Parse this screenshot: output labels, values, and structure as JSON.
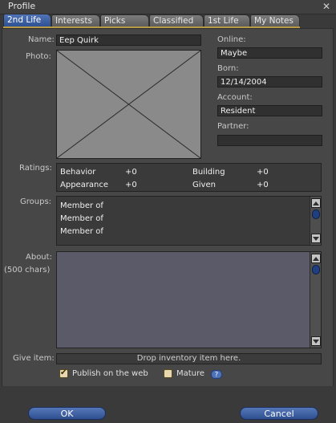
{
  "window": {
    "title": "Profile",
    "close_glyph": "✕"
  },
  "tabs": [
    {
      "label": "2nd Life",
      "active": true
    },
    {
      "label": "Interests",
      "active": false
    },
    {
      "label": "Picks",
      "active": false
    },
    {
      "label": "Classified",
      "active": false
    },
    {
      "label": "1st Life",
      "active": false
    },
    {
      "label": "My Notes",
      "active": false
    }
  ],
  "labels": {
    "name": "Name:",
    "photo": "Photo:",
    "online": "Online:",
    "born": "Born:",
    "account": "Account:",
    "partner": "Partner:",
    "ratings": "Ratings:",
    "groups": "Groups:",
    "about": "About:",
    "about_hint": "(500 chars)",
    "give_item": "Give item:"
  },
  "values": {
    "name": "Eep Quirk",
    "online": "Maybe",
    "born": "12/14/2004",
    "account": "Resident",
    "partner": ""
  },
  "ratings": [
    {
      "label": "Behavior",
      "value": "+0"
    },
    {
      "label": "Building",
      "value": "+0"
    },
    {
      "label": "Appearance",
      "value": "+0"
    },
    {
      "label": "Given",
      "value": "+0"
    }
  ],
  "groups": [
    "Member of",
    "Member of",
    "Member of"
  ],
  "about_text": "",
  "give_item_placeholder": "Drop inventory item here.",
  "options": {
    "publish_label": "Publish on the web",
    "publish_checked": true,
    "mature_label": "Mature",
    "mature_checked": false,
    "help_glyph": "?"
  },
  "buttons": {
    "ok": "OK",
    "cancel": "Cancel"
  },
  "colors": {
    "accent": "#4f73b6",
    "tab_underline": "#b89a46",
    "panel": "#474747"
  },
  "icons": {
    "close": "close-icon",
    "help": "help-icon",
    "scroll_up": "arrow-up-icon",
    "scroll_down": "arrow-down-icon"
  }
}
